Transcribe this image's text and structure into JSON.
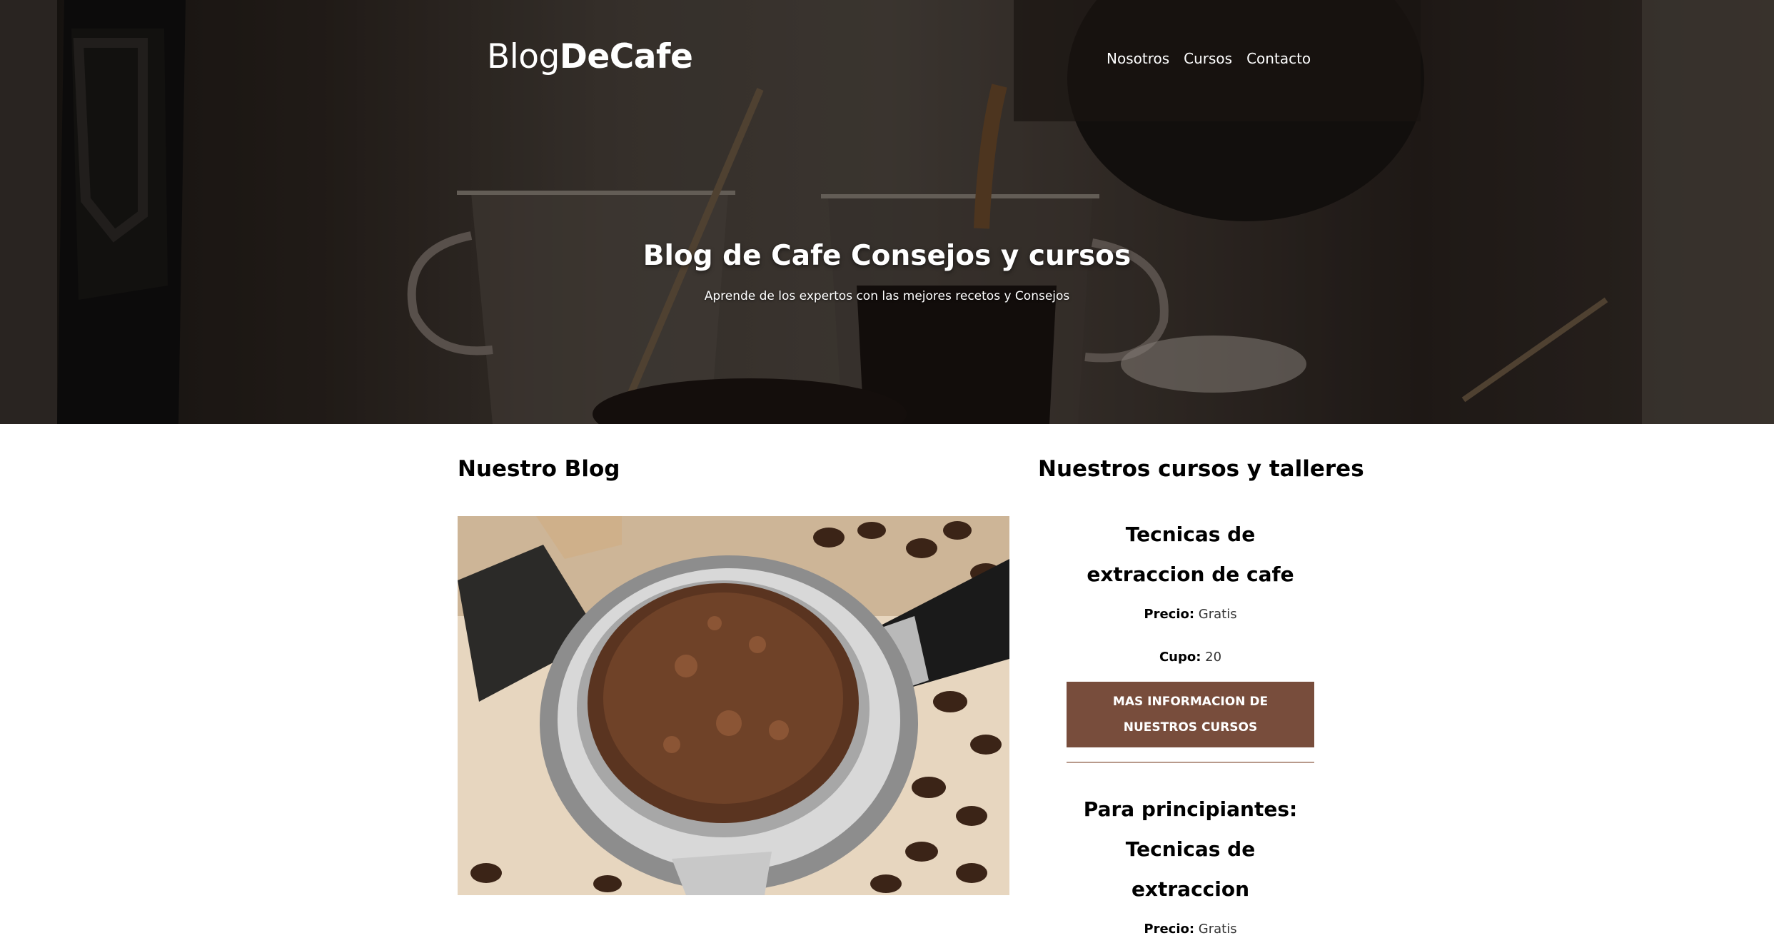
{
  "header": {
    "logo_light": "Blog",
    "logo_bold": "DeCafe",
    "nav": [
      "Nosotros",
      "Cursos",
      "Contacto"
    ],
    "title": "Blog de Cafe Consejos y cursos",
    "subtitle": "Aprende de los expertos con las mejores recetos y Consejos"
  },
  "blog": {
    "heading": "Nuestro Blog"
  },
  "courses": {
    "heading": "Nuestros cursos y talleres",
    "items": [
      {
        "title": "Tecnicas de extraccion de cafe",
        "price_label": "Precio:",
        "price_value": "Gratis",
        "quota_label": "Cupo:",
        "quota_value": "20",
        "button": "MAS INFORMACION DE NUESTROS CURSOS"
      },
      {
        "title": "Para principiantes: Tecnicas de extraccion",
        "price_label": "Precio:",
        "price_value": "Gratis"
      }
    ]
  },
  "colors": {
    "accent": "#784d3c",
    "divider": "#b89a8c"
  }
}
